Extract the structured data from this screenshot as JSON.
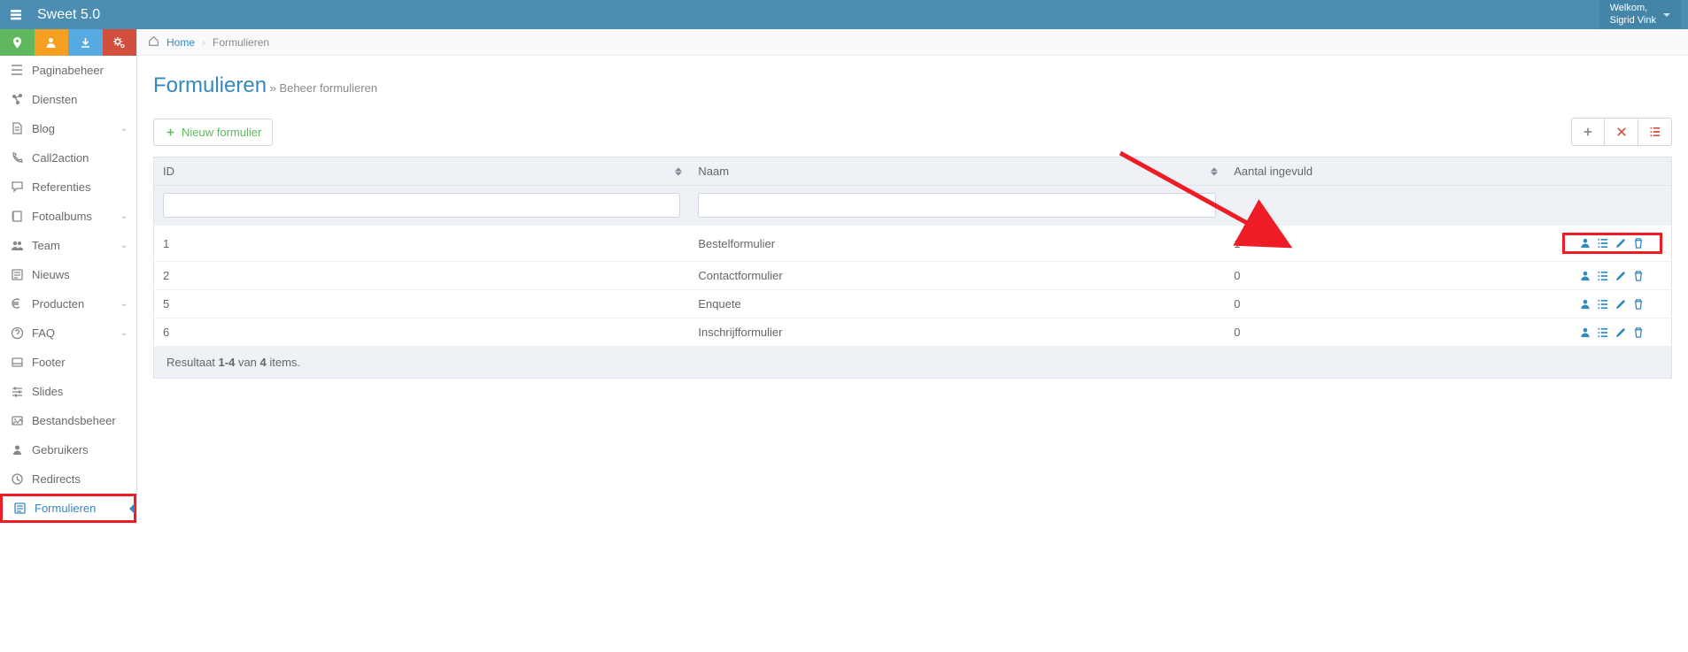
{
  "brand": "Sweet 5.0",
  "welcome_label": "Welkom,",
  "user_name": "Sigrid Vink",
  "breadcrumb": {
    "home": "Home",
    "current": "Formulieren"
  },
  "page": {
    "title": "Formulieren",
    "subtitle": "» Beheer formulieren"
  },
  "new_button": "Nieuw formulier",
  "columns": {
    "id": "ID",
    "naam": "Naam",
    "aantal": "Aantal ingevuld"
  },
  "rows": [
    {
      "id": "1",
      "naam": "Bestelformulier",
      "aantal": "1",
      "highlight": true
    },
    {
      "id": "2",
      "naam": "Contactformulier",
      "aantal": "0",
      "highlight": false
    },
    {
      "id": "5",
      "naam": "Enquete",
      "aantal": "0",
      "highlight": false
    },
    {
      "id": "6",
      "naam": "Inschrijfformulier",
      "aantal": "0",
      "highlight": false
    }
  ],
  "result_summary": {
    "prefix": "Resultaat ",
    "range": "1-4",
    "mid": " van ",
    "total": "4",
    "suffix": " items."
  },
  "sidebar": [
    {
      "label": "Paginabeheer",
      "icon": "bars",
      "expandable": false
    },
    {
      "label": "Diensten",
      "icon": "share",
      "expandable": false
    },
    {
      "label": "Blog",
      "icon": "file",
      "expandable": true
    },
    {
      "label": "Call2action",
      "icon": "phone",
      "expandable": false
    },
    {
      "label": "Referenties",
      "icon": "comment",
      "expandable": false
    },
    {
      "label": "Fotoalbums",
      "icon": "book",
      "expandable": true
    },
    {
      "label": "Team",
      "icon": "users",
      "expandable": true
    },
    {
      "label": "Nieuws",
      "icon": "news",
      "expandable": false
    },
    {
      "label": "Producten",
      "icon": "euro",
      "expandable": true
    },
    {
      "label": "FAQ",
      "icon": "help",
      "expandable": true
    },
    {
      "label": "Footer",
      "icon": "panel",
      "expandable": false
    },
    {
      "label": "Slides",
      "icon": "sliders",
      "expandable": false
    },
    {
      "label": "Bestandsbeheer",
      "icon": "image",
      "expandable": false
    },
    {
      "label": "Gebruikers",
      "icon": "user",
      "expandable": false
    },
    {
      "label": "Redirects",
      "icon": "redirect",
      "expandable": false
    },
    {
      "label": "Formulieren",
      "icon": "form",
      "expandable": false,
      "active": true
    }
  ]
}
